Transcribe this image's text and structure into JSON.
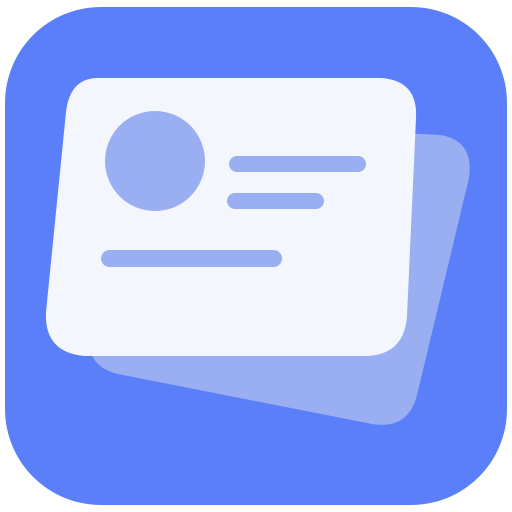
{
  "app_icon": {
    "icon_name": "id-card-stack-icon",
    "colors": {
      "background": "#5B7FF8",
      "back_card": "#9AAEF2",
      "front_card": "#F4F6FD",
      "avatar": "#9AAEF2",
      "text_lines": "#9AAEF2"
    }
  }
}
